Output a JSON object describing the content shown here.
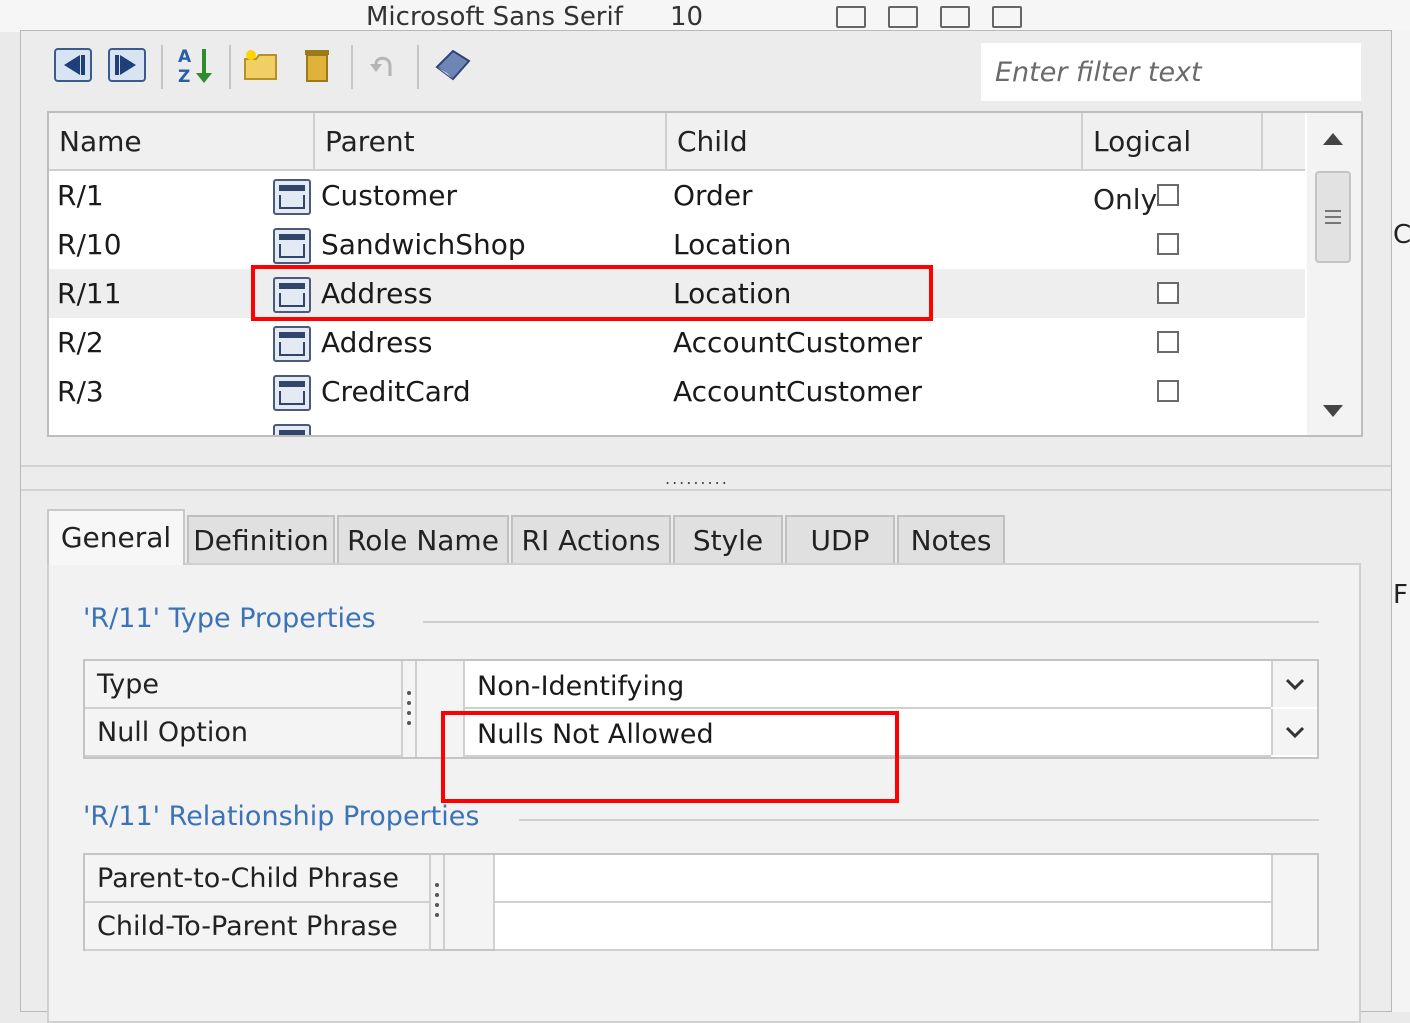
{
  "background_toolbar": {
    "font_name": "Microsoft Sans Serif",
    "font_size": "10"
  },
  "right_strip_letters": [
    "C",
    "F"
  ],
  "toolbar": {
    "filter_placeholder": "Enter filter text"
  },
  "grid": {
    "columns": [
      "Name",
      "Parent",
      "Child",
      "Logical Only"
    ],
    "rows": [
      {
        "name": "R/1",
        "parent": "Customer",
        "child": "Order",
        "logical_only": false
      },
      {
        "name": "R/10",
        "parent": "SandwichShop",
        "child": "Location",
        "logical_only": false
      },
      {
        "name": "R/11",
        "parent": "Address",
        "child": "Location",
        "logical_only": false
      },
      {
        "name": "R/2",
        "parent": "Address",
        "child": "AccountCustomer",
        "logical_only": false
      },
      {
        "name": "R/3",
        "parent": "CreditCard",
        "child": "AccountCustomer",
        "logical_only": false
      }
    ],
    "selected_row": "R/11"
  },
  "tabs": [
    "General",
    "Definition",
    "Role Name",
    "RI Actions",
    "Style",
    "UDP",
    "Notes"
  ],
  "active_tab": "General",
  "type_properties": {
    "title": "'R/11' Type Properties",
    "rows": [
      {
        "label": "Type",
        "value": "Non-Identifying"
      },
      {
        "label": "Null Option",
        "value": "Nulls Not Allowed"
      }
    ]
  },
  "relationship_properties": {
    "title": "'R/11' Relationship Properties",
    "rows": [
      {
        "label": "Parent-to-Child Phrase",
        "value": ""
      },
      {
        "label": "Child-To-Parent Phrase",
        "value": ""
      }
    ]
  },
  "colors": {
    "annotation": "#ff0000",
    "section_title": "#3a73b8"
  }
}
